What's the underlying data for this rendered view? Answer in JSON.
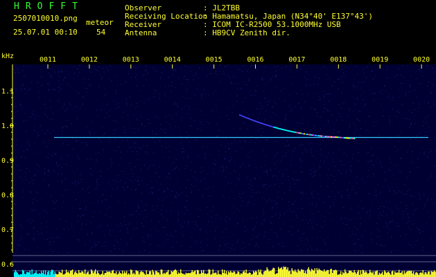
{
  "app": {
    "title": "HROFFT"
  },
  "file": {
    "name": "2507010010.png",
    "datetime": "25.07.01 00:10"
  },
  "counter": {
    "label": "meteor",
    "value": "54"
  },
  "info": [
    {
      "label": "Observer",
      "value": ": JL2TBB"
    },
    {
      "label": "Receiving Location",
      "value": ": Hamamatsu, Japan (N34°40' E137°43')"
    },
    {
      "label": "Receiver",
      "value": ": ICOM IC-R2500 53.1000MHz USB"
    },
    {
      "label": "Antenna",
      "value": ": HB9CV Zenith dir."
    }
  ],
  "spectrogram": {
    "unit": "kHz",
    "time_ticks": [
      "0011",
      "0012",
      "0013",
      "0014",
      "0015",
      "0016",
      "0017",
      "0018",
      "0019",
      "0020"
    ],
    "freq_ticks": [
      "1.1",
      "1.0",
      "0.9",
      "0.8",
      "0.7",
      "0.6"
    ],
    "carrier_khz": 0.965,
    "background_color": "#000033",
    "tick_color": "#ffff33",
    "carrier_color": "#33ccff",
    "meter_color": "#ffff33",
    "meter_color_low": "#00ffff",
    "trail_colors": [
      "#4444ff",
      "#00ffff",
      "#ffff00",
      "#ff5555",
      "#ff66ff"
    ]
  }
}
